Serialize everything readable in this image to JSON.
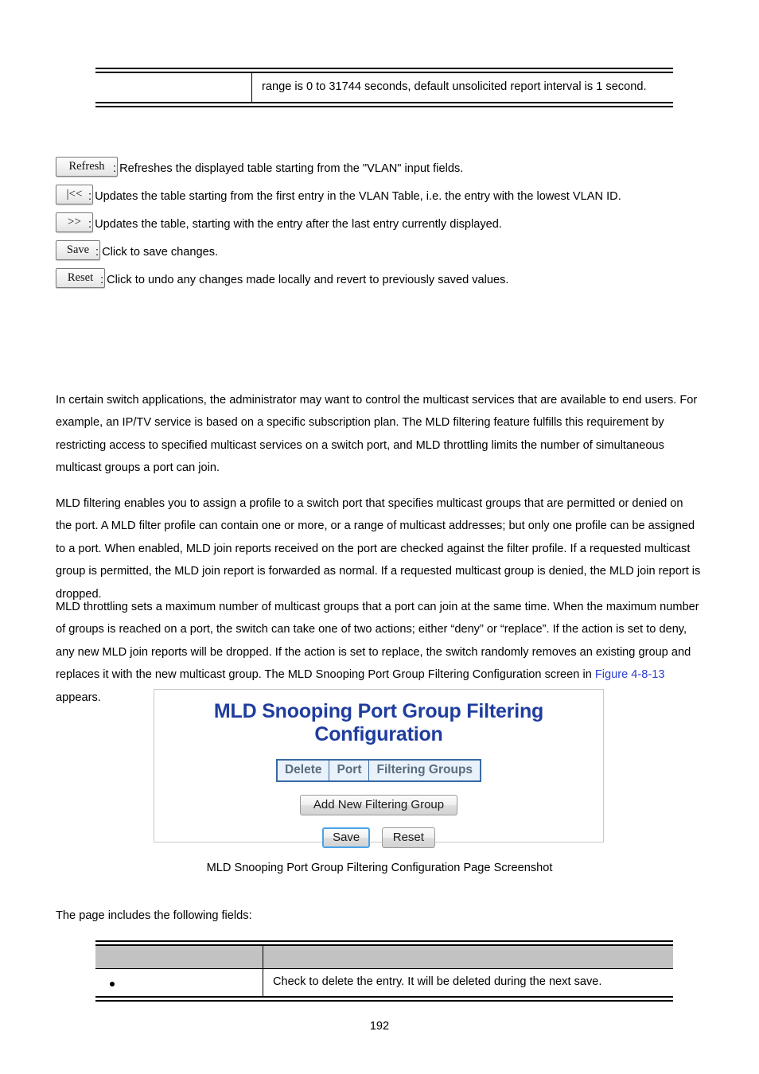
{
  "top_table": {
    "left_cell": "",
    "right_cell": "range is 0 to 31744 seconds, default unsolicited report interval is 1 second."
  },
  "button_legend": [
    {
      "button": "Refresh",
      "description": ": Refreshes the displayed table starting from the \"VLAN\" input fields."
    },
    {
      "button": "|<<",
      "description": ": Updates the table starting from the first entry in the VLAN Table, i.e. the entry with the lowest VLAN ID."
    },
    {
      "button": ">>",
      "description": ": Updates the table, starting with the entry after the last entry currently displayed."
    },
    {
      "button": "Save",
      "description": ": Click to save changes."
    },
    {
      "button": "Reset",
      "description": ": Click to undo any changes made locally and revert to previously saved values."
    }
  ],
  "paragraphs": {
    "p1": "In certain switch applications, the administrator may want to control the multicast services that are available to end users. For example, an IP/TV service is based on a specific subscription plan. The MLD filtering feature fulfills this requirement by restricting access to specified multicast services on a switch port, and MLD throttling limits the number of simultaneous multicast groups a port can join.",
    "p2": "MLD filtering enables you to assign a profile to a switch port that specifies multicast groups that are permitted or denied on the port. A MLD filter profile can contain one or more, or a range of multicast addresses; but only one profile can be assigned to a port. When enabled, MLD join reports received on the port are checked against the filter profile. If a requested multicast group is permitted, the MLD join report is forwarded as normal. If a requested multicast group is denied, the MLD join report is dropped.",
    "p3_part1": "MLD throttling sets a maximum number of multicast groups that a port can join at the same time. When the maximum number of groups is reached on a port, the switch can take one of two actions; either “deny” or “replace”. If the action is set to deny, any new MLD join reports will be dropped. If the action is set to replace, the switch randomly removes an existing group and replaces it with the new multicast group. The MLD Snooping Port Group Filtering Configuration screen in ",
    "p3_link": "Figure 4-8-13",
    "p3_part2": " appears."
  },
  "screenshot": {
    "title": "MLD Snooping Port Group Filtering Configuration",
    "table_headers": [
      "Delete",
      "Port",
      "Filtering Groups"
    ],
    "add_button": "Add New Filtering Group",
    "save_button": "Save",
    "reset_button": "Reset",
    "title_color": "#1f3d9e",
    "header_bg": "#e9f2fb",
    "header_border": "#3a6aa5",
    "focus_color": "#4aa3e8"
  },
  "figure_caption": "MLD Snooping Port Group Filtering Configuration Page Screenshot",
  "includes_line": "The page includes the following fields:",
  "fields_table": {
    "header": [
      "",
      ""
    ],
    "rows": [
      {
        "name": "",
        "description": "Check to delete the entry. It will be deleted during the next save."
      }
    ]
  },
  "page_number": "192"
}
